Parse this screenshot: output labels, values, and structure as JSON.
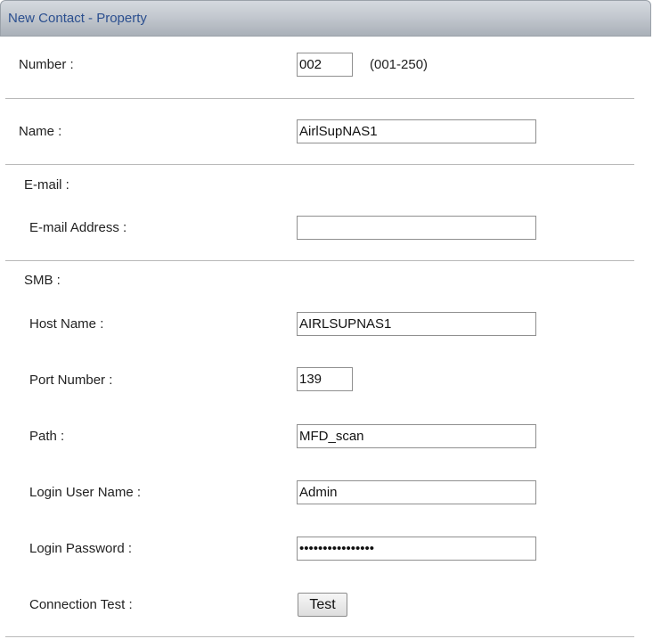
{
  "window": {
    "title": "New Contact - Property"
  },
  "number": {
    "label": "Number :",
    "value": "002",
    "range": "(001-250)"
  },
  "name": {
    "label": "Name :",
    "value": "AirlSupNAS1"
  },
  "email": {
    "section": "E-mail :",
    "address_label": "E-mail Address :",
    "address_value": ""
  },
  "smb": {
    "section": "SMB :",
    "host_label": "Host Name :",
    "host_value": "AIRLSUPNAS1",
    "port_label": "Port Number :",
    "port_value": "139",
    "path_label": "Path :",
    "path_value": "MFD_scan",
    "user_label": "Login User Name :",
    "user_value": "Admin",
    "password_label": "Login Password :",
    "password_value": "••••••••••••••••",
    "test_label": "Connection Test :",
    "test_button": "Test"
  }
}
